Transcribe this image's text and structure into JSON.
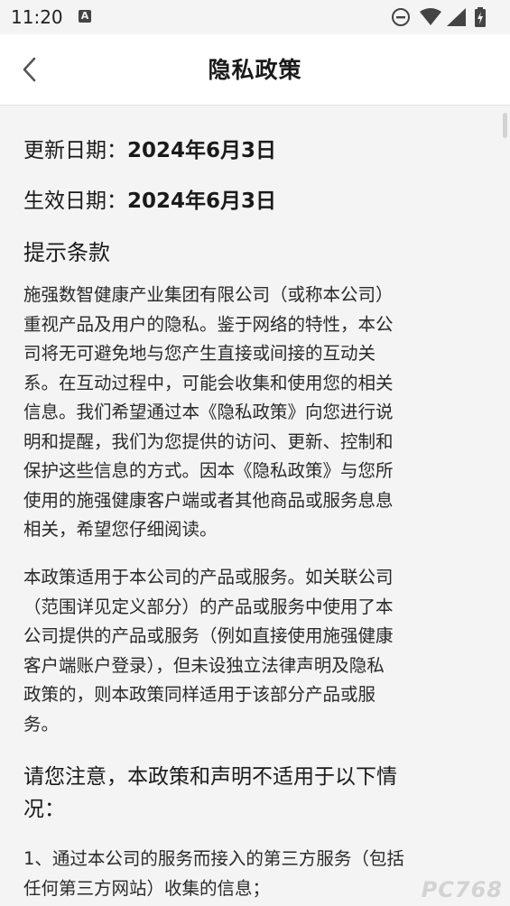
{
  "status_bar": {
    "time": "11:20",
    "notification_letter": "A"
  },
  "header": {
    "title": "隐私政策"
  },
  "content": {
    "update_label": "更新日期：",
    "update_date": "2024年6月3日",
    "effective_label": "生效日期：",
    "effective_date": "2024年6月3日",
    "section_title": "提示条款",
    "para1_lines": [
      "施强数智健康产业集团有限公司（或称本公司）",
      "重视产品及用户的隐私。鉴于网络的特性，本公",
      "司将无可避免地与您产生直接或间接的互动关",
      "系。在互动过程中，可能会收集和使用您的相关",
      "信息。我们希望通过本《隐私政策》向您进行说",
      "明和提醒，我们为您提供的访问、更新、控制和",
      "保护这些信息的方式。因本《隐私政策》与您所",
      "使用的施强健康客户端或者其他商品或服务息息",
      "相关，希望您仔细阅读。"
    ],
    "para2_lines": [
      "本政策适用于本公司的产品或服务。如关联公司",
      "（范围详见定义部分）的产品或服务中使用了本",
      "公司提供的产品或服务（例如直接使用施强健康",
      "客户端账户登录），但未设独立法律声明及隐私",
      "政策的，则本政策同样适用于该部分产品或服",
      "务。"
    ],
    "notice_lines": [
      "请您注意，本政策和声明不适用于以下情",
      "况："
    ],
    "item1_lines": [
      "1、通过本公司的服务而接入的第三方服务（包括",
      "任何第三方网站）收集的信息；"
    ]
  },
  "watermark": "PC768"
}
